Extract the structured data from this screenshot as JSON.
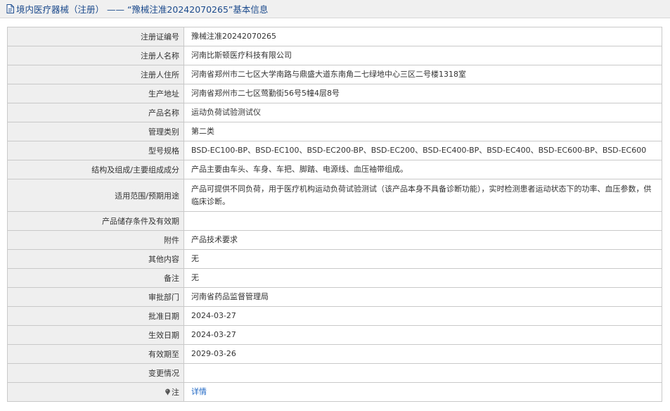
{
  "header": {
    "title": "境内医疗器械（注册） —— “豫械注准20242070265”基本信息"
  },
  "rows": [
    {
      "label": "注册证编号",
      "value": "豫械注准20242070265"
    },
    {
      "label": "注册人名称",
      "value": "河南比斯顿医疗科技有限公司"
    },
    {
      "label": "注册人住所",
      "value": "河南省郑州市二七区大学南路与鼎盛大道东南角二七绿地中心三区二号楼1318室"
    },
    {
      "label": "生产地址",
      "value": "河南省郑州市二七区莺勤街56号5幢4层8号"
    },
    {
      "label": "产品名称",
      "value": "运动负荷试验测试仪"
    },
    {
      "label": "管理类别",
      "value": "第二类"
    },
    {
      "label": "型号规格",
      "value": "BSD-EC100-BP、BSD-EC100、BSD-EC200-BP、BSD-EC200、BSD-EC400-BP、BSD-EC400、BSD-EC600-BP、BSD-EC600"
    },
    {
      "label": "结构及组成/主要组成成分",
      "value": "产品主要由车头、车身、车把、脚踏、电源线、血压袖带组成。"
    },
    {
      "label": "适用范围/预期用途",
      "value": "产品可提供不同负荷，用于医疗机构运动负荷试验测试（该产品本身不具备诊断功能），实时检测患者运动状态下的功率、血压参数，供临床诊断。"
    },
    {
      "label": "产品储存条件及有效期",
      "value": ""
    },
    {
      "label": "附件",
      "value": "产品技术要求"
    },
    {
      "label": "其他内容",
      "value": "无"
    },
    {
      "label": "备注",
      "value": "无"
    },
    {
      "label": "审批部门",
      "value": "河南省药品监督管理局"
    },
    {
      "label": "批准日期",
      "value": "2024-03-27"
    },
    {
      "label": "生效日期",
      "value": "2024-03-27"
    },
    {
      "label": "有效期至",
      "value": "2029-03-26"
    },
    {
      "label": "变更情况",
      "value": ""
    }
  ],
  "note": {
    "label": "注",
    "link_text": "详情"
  },
  "colors": {
    "header_text": "#1b4a8c",
    "link": "#1f67c4",
    "label_bg": "#efefef",
    "border": "#c9c9c9"
  }
}
